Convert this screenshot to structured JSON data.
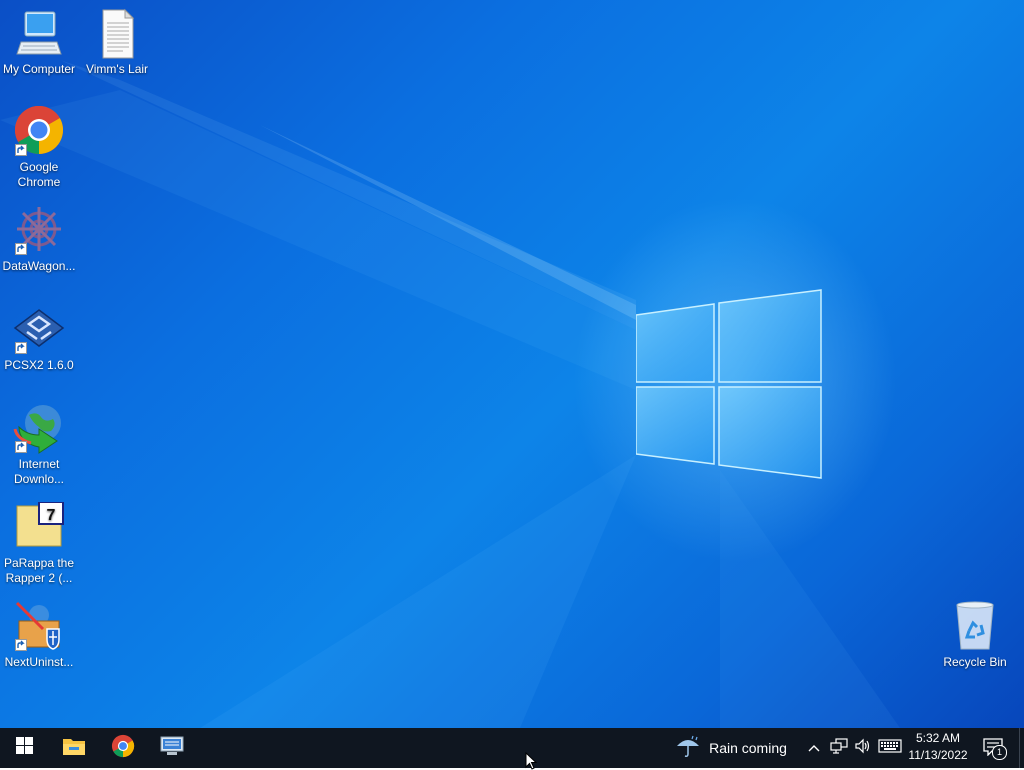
{
  "desktop": {
    "icons": [
      {
        "name": "my-computer",
        "label": "My Computer",
        "icon": "computer-icon",
        "shortcut": false
      },
      {
        "name": "vimms-lair",
        "label": "Vimm's Lair",
        "icon": "text-file-icon",
        "shortcut": false
      },
      {
        "name": "google-chrome",
        "label": "Google Chrome",
        "icon": "chrome-icon",
        "shortcut": true
      },
      {
        "name": "datawagon",
        "label": "DataWagon...",
        "icon": "datawagon-icon",
        "shortcut": true
      },
      {
        "name": "pcsx2",
        "label": "PCSX2 1.6.0",
        "icon": "pcsx2-icon",
        "shortcut": true
      },
      {
        "name": "internet-download-manager",
        "label": "Internet Downlo...",
        "icon": "idm-icon",
        "shortcut": true
      },
      {
        "name": "parappa-the-rapper-2",
        "label": "PaRappa the Rapper 2 (...",
        "icon": "7zip-archive-icon",
        "shortcut": false
      },
      {
        "name": "nextuninstaller",
        "label": "NextUninst...",
        "icon": "uninstaller-icon",
        "shortcut": true
      },
      {
        "name": "recycle-bin",
        "label": "Recycle Bin",
        "icon": "recycle-bin-icon",
        "shortcut": false
      }
    ]
  },
  "taskbar": {
    "pinned": [
      {
        "name": "start-button",
        "icon": "windows-logo-icon"
      },
      {
        "name": "file-explorer",
        "icon": "folder-icon"
      },
      {
        "name": "chrome",
        "icon": "chrome-icon"
      },
      {
        "name": "remote-desktop",
        "icon": "remote-desktop-icon"
      }
    ],
    "weather": {
      "text": "Rain coming",
      "icon": "rain-umbrella-icon"
    },
    "tray": {
      "icons": [
        "chevron-up-icon",
        "network-icon",
        "volume-icon",
        "keyboard-icon"
      ],
      "time": "5:32 AM",
      "date": "11/13/2022",
      "notifications": {
        "count": "1",
        "icon": "action-center-icon"
      }
    }
  }
}
